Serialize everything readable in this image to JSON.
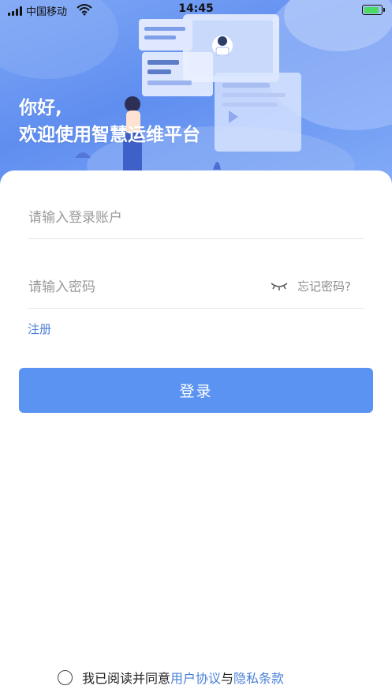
{
  "status_bar": {
    "carrier": "中国移动",
    "time": "14:45"
  },
  "hero": {
    "greeting_line1": "你好,",
    "greeting_line2": "欢迎使用智慧运维平台"
  },
  "login_form": {
    "account_placeholder": "请输入登录账户",
    "password_placeholder": "请输入密码",
    "forgot_password": "忘记密码?",
    "register_link": "注册",
    "login_button": "登录"
  },
  "agreement": {
    "prefix": "我已阅读并同意",
    "user_agreement": "用户协议",
    "conjunction": "与",
    "privacy_terms": "隐私条款"
  },
  "colors": {
    "accent": "#5b93f3",
    "link": "#4a7fd8",
    "hero_gradient": "#6f9bf2"
  },
  "icons": [
    "signal-icon",
    "wifi-icon",
    "battery-icon",
    "eye-closed-icon",
    "radio-unchecked-icon"
  ]
}
